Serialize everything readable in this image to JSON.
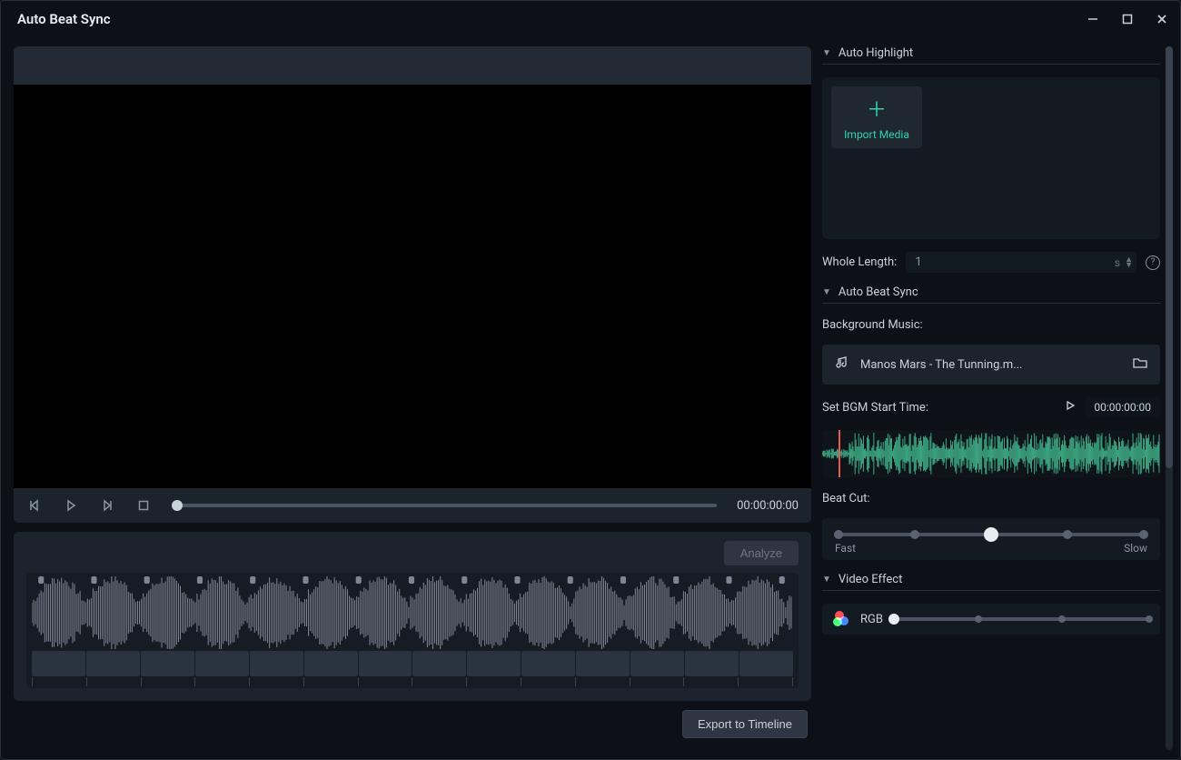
{
  "window": {
    "title": "Auto Beat Sync"
  },
  "preview": {
    "timecode": "00:00:00:00"
  },
  "analyze": {
    "button_label": "Analyze"
  },
  "export": {
    "button_label": "Export to Timeline"
  },
  "sidebar": {
    "auto_highlight": {
      "title": "Auto Highlight",
      "import_label": "Import Media",
      "whole_length_label": "Whole Length:",
      "whole_length_value": "1",
      "whole_length_unit": "s"
    },
    "auto_beat_sync": {
      "title": "Auto Beat Sync",
      "bgm_label": "Background Music:",
      "music_filename": "Manos Mars - The Tunning.m...",
      "start_time_label": "Set BGM Start Time:",
      "start_time_value": "00:00:00:00",
      "beat_cut_label": "Beat Cut:",
      "slider_fast": "Fast",
      "slider_slow": "Slow"
    },
    "video_effect": {
      "title": "Video Effect",
      "rgb_label": "RGB"
    }
  }
}
